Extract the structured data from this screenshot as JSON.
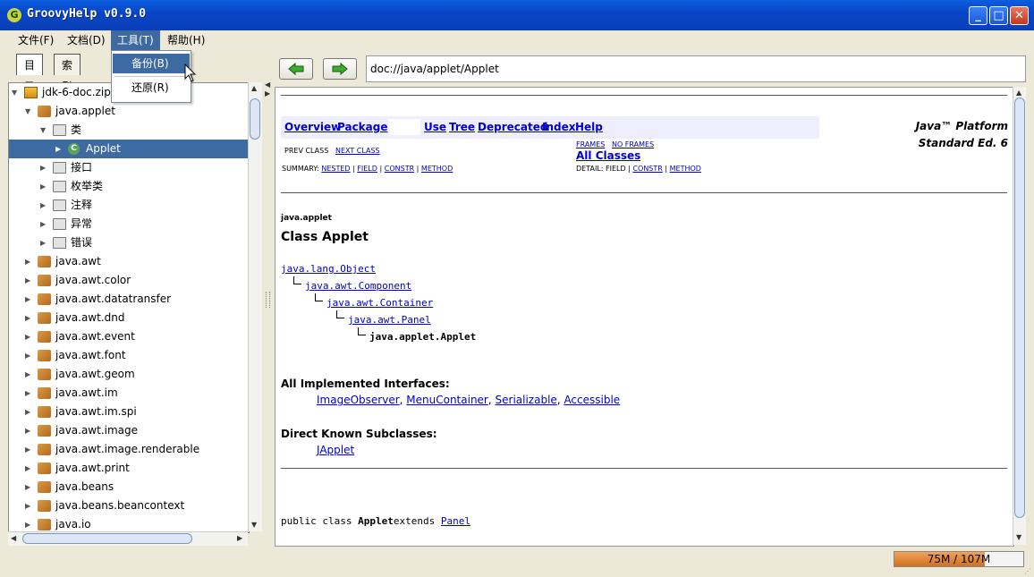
{
  "window": {
    "title": "GroovyHelp v0.9.0",
    "app_icon": "G"
  },
  "menubar": {
    "items": [
      "文件(F)",
      "文档(D)",
      "工具(T)",
      "帮助(H)"
    ],
    "active_index": 2
  },
  "tools_menu": {
    "items": [
      "备份(B)",
      "还原(R)"
    ],
    "highlighted_index": 0
  },
  "left_tabs": [
    "目录",
    "索引"
  ],
  "tree": [
    {
      "label": "jdk-6-doc.zip",
      "depth": 0,
      "icon": "zip-icon",
      "expanded": true
    },
    {
      "label": "java.applet",
      "depth": 1,
      "icon": "package-icon",
      "expanded": true
    },
    {
      "label": "类",
      "depth": 2,
      "icon": "folder-icon",
      "expanded": true
    },
    {
      "label": "Applet",
      "depth": 3,
      "icon": "class-icon",
      "expanded": false,
      "selected": true
    },
    {
      "label": "接口",
      "depth": 2,
      "icon": "folder-icon",
      "expanded": false
    },
    {
      "label": "枚举类",
      "depth": 2,
      "icon": "folder-icon",
      "expanded": false
    },
    {
      "label": "注释",
      "depth": 2,
      "icon": "folder-icon",
      "expanded": false
    },
    {
      "label": "异常",
      "depth": 2,
      "icon": "folder-icon",
      "expanded": false
    },
    {
      "label": "错误",
      "depth": 2,
      "icon": "folder-icon",
      "expanded": false
    },
    {
      "label": "java.awt",
      "depth": 1,
      "icon": "package-icon",
      "expanded": false
    },
    {
      "label": "java.awt.color",
      "depth": 1,
      "icon": "package-icon",
      "expanded": false
    },
    {
      "label": "java.awt.datatransfer",
      "depth": 1,
      "icon": "package-icon",
      "expanded": false
    },
    {
      "label": "java.awt.dnd",
      "depth": 1,
      "icon": "package-icon",
      "expanded": false
    },
    {
      "label": "java.awt.event",
      "depth": 1,
      "icon": "package-icon",
      "expanded": false
    },
    {
      "label": "java.awt.font",
      "depth": 1,
      "icon": "package-icon",
      "expanded": false
    },
    {
      "label": "java.awt.geom",
      "depth": 1,
      "icon": "package-icon",
      "expanded": false
    },
    {
      "label": "java.awt.im",
      "depth": 1,
      "icon": "package-icon",
      "expanded": false
    },
    {
      "label": "java.awt.im.spi",
      "depth": 1,
      "icon": "package-icon",
      "expanded": false
    },
    {
      "label": "java.awt.image",
      "depth": 1,
      "icon": "package-icon",
      "expanded": false
    },
    {
      "label": "java.awt.image.renderable",
      "depth": 1,
      "icon": "package-icon",
      "expanded": false
    },
    {
      "label": "java.awt.print",
      "depth": 1,
      "icon": "package-icon",
      "expanded": false
    },
    {
      "label": "java.beans",
      "depth": 1,
      "icon": "package-icon",
      "expanded": false
    },
    {
      "label": "java.beans.beancontext",
      "depth": 1,
      "icon": "package-icon",
      "expanded": false
    },
    {
      "label": "java.io",
      "depth": 1,
      "icon": "package-icon",
      "expanded": false
    }
  ],
  "toolbar": {
    "back_icon": "back-arrow-icon",
    "forward_icon": "forward-arrow-icon",
    "address": "doc://java/applet/Applet"
  },
  "doc": {
    "nav_links": [
      "Overview",
      "Package",
      "Use",
      "Tree",
      "Deprecated",
      "Index",
      "Help"
    ],
    "platform_line1": "Java™ Platform",
    "platform_line2": "Standard Ed. 6",
    "prev_class": "PREV CLASS",
    "next_class": "NEXT CLASS",
    "frames": "FRAMES",
    "no_frames": "NO FRAMES",
    "all_classes": "All Classes",
    "summary_label": "SUMMARY:",
    "summary_links": [
      "NESTED",
      "FIELD",
      "CONSTR",
      "METHOD"
    ],
    "detail_label": "DETAIL:",
    "detail_plain": "FIELD",
    "detail_links": [
      "CONSTR",
      "METHOD"
    ],
    "package_name": "java.applet",
    "class_title": "Class Applet",
    "hierarchy": [
      "java.lang.Object",
      "java.awt.Component",
      "java.awt.Container",
      "java.awt.Panel",
      "java.applet.Applet"
    ],
    "interfaces_heading": "All Implemented Interfaces:",
    "interfaces": [
      "ImageObserver",
      "MenuContainer",
      "Serializable",
      "Accessible"
    ],
    "subclasses_heading": "Direct Known Subclasses:",
    "subclasses": [
      "JApplet"
    ],
    "decl_prefix": "public class ",
    "decl_name": "Applet",
    "decl_extends": "extends ",
    "decl_super": "Panel"
  },
  "status": {
    "memory": "75M / 107M",
    "memory_used_fraction": 0.7
  },
  "colors": {
    "selection": "#3d6ba1",
    "link": "#0000cc",
    "memory_bar": "#e08a36"
  }
}
